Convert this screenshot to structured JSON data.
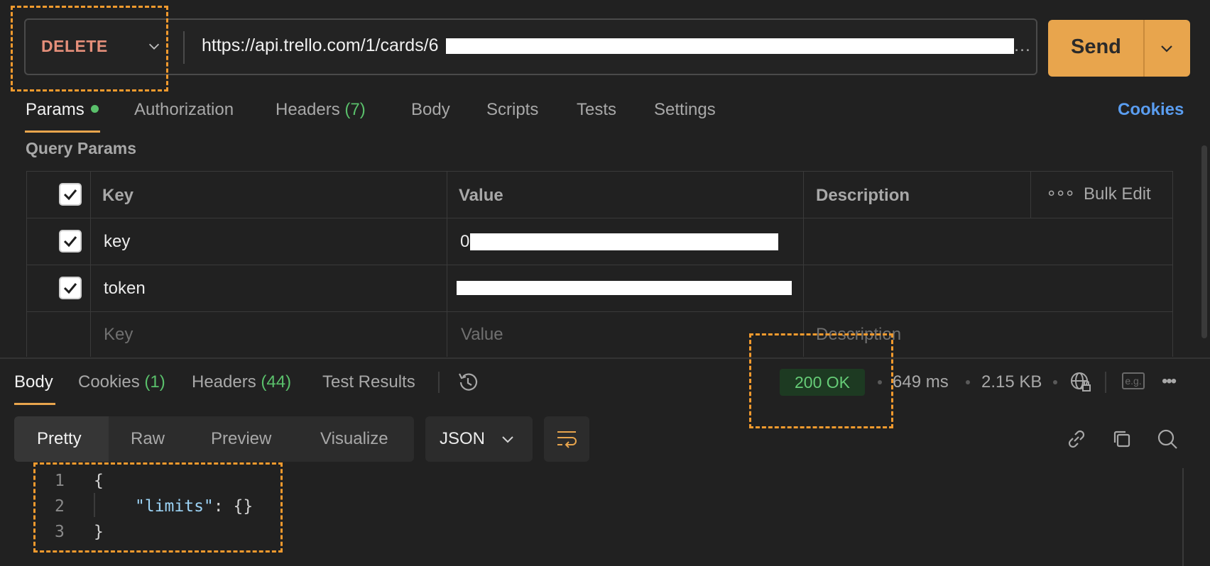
{
  "request": {
    "method": "DELETE",
    "url": "https://api.trello.com/1/cards/6",
    "send_label": "Send"
  },
  "tabs": [
    {
      "label": "Params"
    },
    {
      "label": "Authorization"
    },
    {
      "label": "Headers",
      "count": "(7)"
    },
    {
      "label": "Body"
    },
    {
      "label": "Scripts"
    },
    {
      "label": "Tests"
    },
    {
      "label": "Settings"
    }
  ],
  "cookies_label": "Cookies",
  "query_params": {
    "title": "Query Params",
    "headers": {
      "key": "Key",
      "value": "Value",
      "description": "Description",
      "bulk_edit": "Bulk Edit"
    },
    "rows": [
      {
        "key": "key",
        "value_prefix": "0",
        "checked": true
      },
      {
        "key": "token",
        "value_prefix": "",
        "checked": true
      }
    ],
    "placeholder": {
      "key": "Key",
      "value": "Value",
      "description": "Description"
    }
  },
  "response": {
    "tabs": [
      {
        "label": "Body"
      },
      {
        "label": "Cookies",
        "count": "(1)"
      },
      {
        "label": "Headers",
        "count": "(44)"
      },
      {
        "label": "Test Results"
      }
    ],
    "status": "200 OK",
    "time": "649 ms",
    "size": "2.15 KB",
    "eg_label": "e.g.",
    "formats": [
      "Pretty",
      "Raw",
      "Preview",
      "Visualize"
    ],
    "language": "JSON",
    "code_lines": [
      {
        "n": "1",
        "text": "{"
      },
      {
        "n": "2",
        "key": "\"limits\"",
        "rest": ": {}"
      },
      {
        "n": "3",
        "text": "}"
      }
    ]
  },
  "colors": {
    "accent": "#e8a54d",
    "method": "#e58f7a",
    "success": "#66cc77",
    "link": "#5a9df0",
    "highlight": "#f29a2e"
  }
}
